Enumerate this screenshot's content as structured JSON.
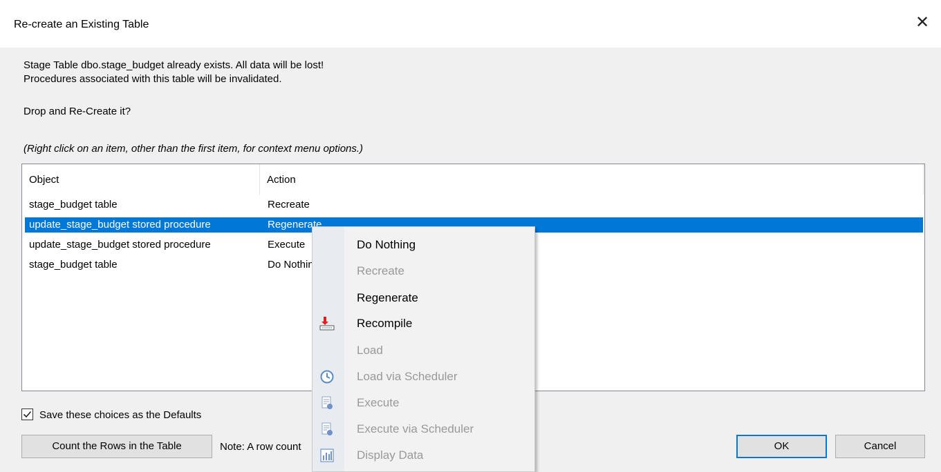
{
  "dialog": {
    "title": "Re-create an Existing Table",
    "close_glyph": "✕",
    "message_line1": "Stage Table dbo.stage_budget already exists. All data will be lost!",
    "message_line2": "Procedures associated with this table will be invalidated.",
    "question": "Drop and Re-Create it?",
    "hint": "(Right click on an item, other than the first item, for context menu options.)"
  },
  "list": {
    "columns": [
      "Object",
      "Action"
    ],
    "rows": [
      {
        "object": "stage_budget table",
        "action": "Recreate",
        "selected": false
      },
      {
        "object": "update_stage_budget stored procedure",
        "action": "Regenerate",
        "selected": true
      },
      {
        "object": "update_stage_budget stored procedure",
        "action": "Execute",
        "selected": false
      },
      {
        "object": "stage_budget table",
        "action": "Do Nothing",
        "selected": false
      }
    ]
  },
  "defaults_checkbox": {
    "label": "Save these choices as the Defaults",
    "checked": true
  },
  "buttons": {
    "count_rows": "Count the Rows in the Table",
    "ok": "OK",
    "cancel": "Cancel"
  },
  "note": "Note: A row count",
  "context_menu": {
    "items": [
      {
        "label": "Do Nothing",
        "enabled": true,
        "icon": null
      },
      {
        "label": "Recreate",
        "enabled": false,
        "icon": null
      },
      {
        "label": "Regenerate",
        "enabled": true,
        "icon": null
      },
      {
        "label": "Recompile",
        "enabled": true,
        "icon": "recompile-icon"
      },
      {
        "label": "Load",
        "enabled": false,
        "icon": null
      },
      {
        "label": "Load via Scheduler",
        "enabled": false,
        "icon": "clock-icon"
      },
      {
        "label": "Execute",
        "enabled": false,
        "icon": "execute-icon"
      },
      {
        "label": "Execute via Scheduler",
        "enabled": false,
        "icon": "execute-icon"
      },
      {
        "label": "Display Data",
        "enabled": false,
        "icon": "bar-chart-icon"
      }
    ]
  },
  "colors": {
    "selection": "#0078d7",
    "disabled_text": "#999999",
    "dialog_bg": "#f0f0f0"
  }
}
